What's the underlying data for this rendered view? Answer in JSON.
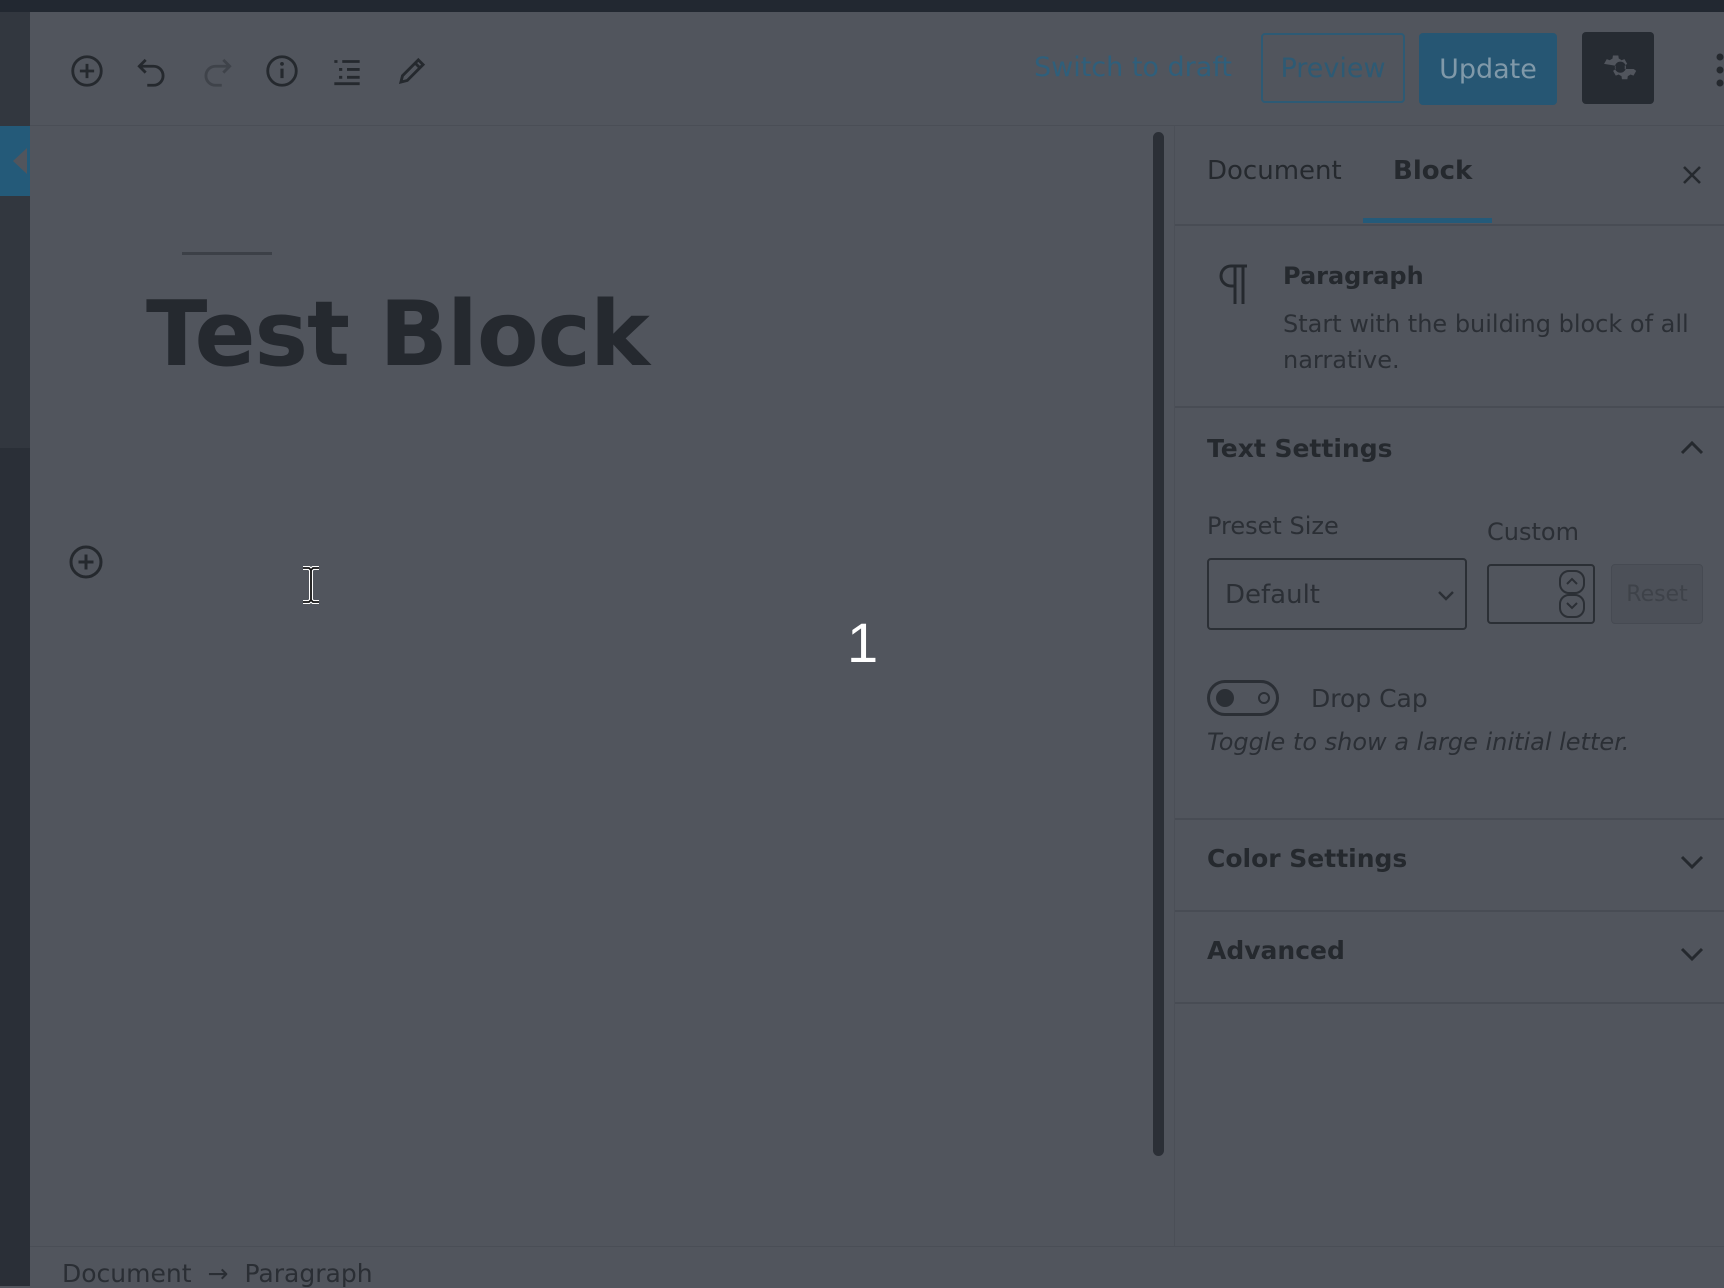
{
  "toolbar": {
    "switch_to_draft": "Switch to draft",
    "preview": "Preview",
    "update": "Update",
    "icons": [
      "add-block-icon",
      "undo-icon",
      "redo-icon",
      "info-icon",
      "outline-icon",
      "edit-icon"
    ]
  },
  "editor": {
    "post_title": "Test Block",
    "marker": "1"
  },
  "breadcrumb": {
    "items": [
      "Document",
      "Paragraph"
    ],
    "separator": "→"
  },
  "sidebar": {
    "tabs": [
      "Document",
      "Block"
    ],
    "active_tab": "Block",
    "block": {
      "name": "Paragraph",
      "description": "Start with the building block of all narrative."
    },
    "text_settings": {
      "title": "Text Settings",
      "preset_label": "Preset Size",
      "preset_value": "Default",
      "custom_label": "Custom",
      "reset": "Reset",
      "drop_cap_label": "Drop Cap",
      "drop_cap_help": "Toggle to show a large initial letter."
    },
    "color_settings": {
      "title": "Color Settings"
    },
    "advanced": {
      "title": "Advanced"
    }
  },
  "colors": {
    "overlay": "#51555d",
    "accent": "#245a79",
    "text": "#25292e"
  }
}
